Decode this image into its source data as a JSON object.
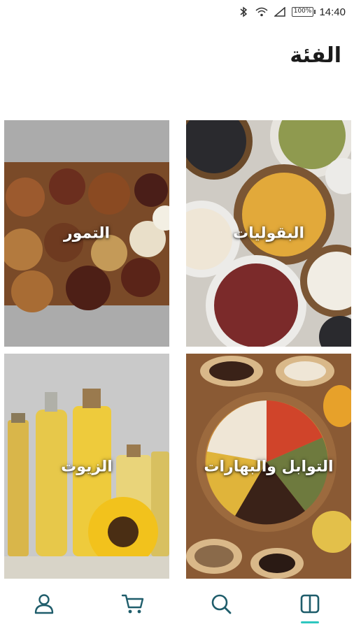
{
  "status_bar": {
    "time": "14:40",
    "battery": "100%"
  },
  "header": {
    "title": "الفئة"
  },
  "categories": [
    {
      "label": "البقوليات"
    },
    {
      "label": "التمور"
    },
    {
      "label": "التوابل والبهارات"
    },
    {
      "label": "الزيوت"
    }
  ],
  "bottom_nav": {
    "items": [
      "account-icon",
      "cart-icon",
      "search-icon",
      "catalog-icon"
    ],
    "active": "catalog-icon",
    "icon_color": "#1f5d6b",
    "accent_color": "#2ec7c0"
  }
}
